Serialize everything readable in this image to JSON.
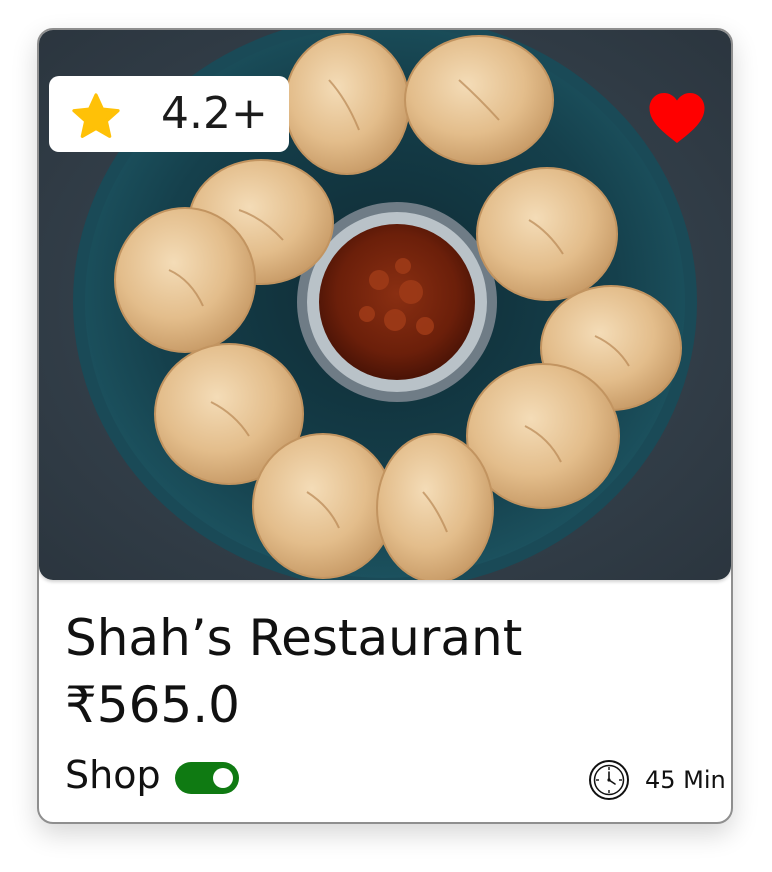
{
  "card": {
    "rating": "4.2+",
    "name": "Shah’s Restaurant",
    "price": "₹565.0",
    "shop_label": "Shop",
    "shop_toggle_on": true,
    "delivery_time": "45 Min"
  },
  "icons": {
    "rating": "star-icon",
    "favorite": "heart-icon",
    "time": "clock-icon"
  },
  "colors": {
    "star": "#FFC107",
    "heart": "#FF0000",
    "toggle_on": "#0F7A12"
  }
}
